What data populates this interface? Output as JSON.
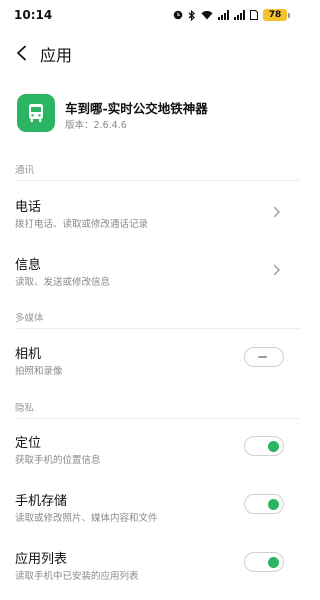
{
  "status_bar": {
    "time": "10:14",
    "battery": "78",
    "icons": [
      "clock-icon",
      "bluetooth-icon",
      "wifi-icon",
      "signal-icon",
      "signal-icon",
      "sim-icon",
      "battery-icon"
    ]
  },
  "header": {
    "back_icon": "back-arrow-icon",
    "title": "应用"
  },
  "app": {
    "name": "车到哪-实时公交地铁神器",
    "version": "版本：2.6.4.6",
    "icon": "bus-icon",
    "icon_color": "#2bb462"
  },
  "sections": {
    "communication": "通讯",
    "multimedia": "多媒体",
    "privacy": "隐私"
  },
  "permissions": {
    "phone": {
      "title": "电话",
      "desc": "拨打电话、读取或修改通话记录"
    },
    "messages": {
      "title": "信息",
      "desc": "读取、发送或修改信息"
    },
    "camera": {
      "title": "相机",
      "desc": "拍照和录像",
      "enabled": false
    },
    "location": {
      "title": "定位",
      "desc": "获取手机的位置信息",
      "enabled": true
    },
    "storage": {
      "title": "手机存储",
      "desc": "读取或修改照片、媒体内容和文件",
      "enabled": true
    },
    "app_list": {
      "title": "应用列表",
      "desc": "读取手机中已安装的应用列表",
      "enabled": true
    }
  },
  "colors": {
    "toggle_on": "#2bb462",
    "text_primary": "#111111",
    "text_secondary": "#8a8a8a"
  }
}
